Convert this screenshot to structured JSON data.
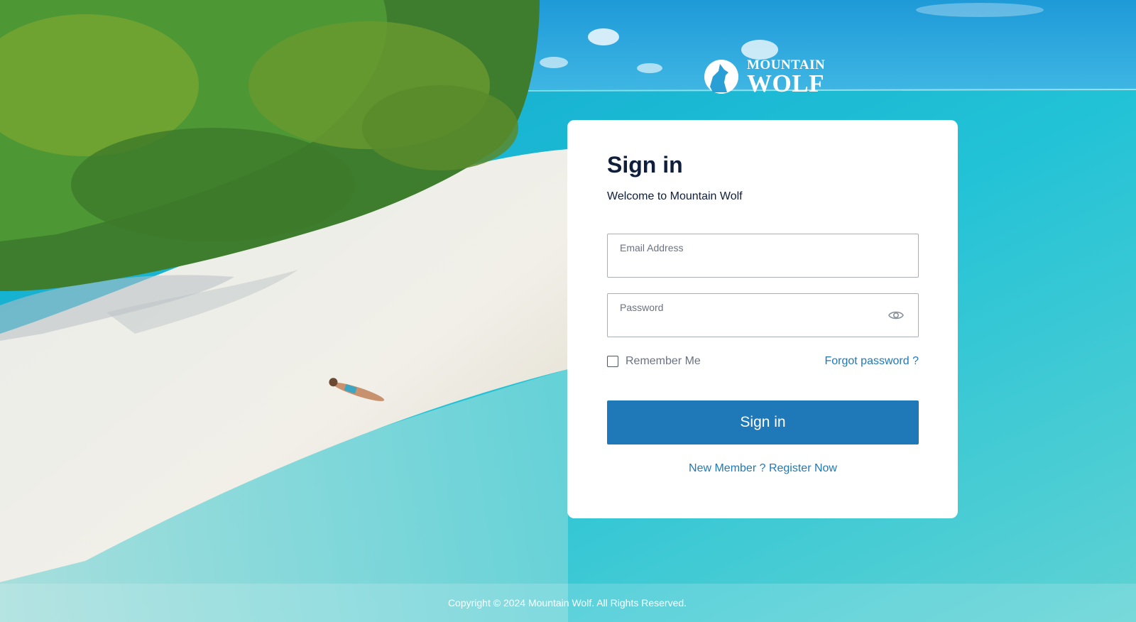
{
  "brand": {
    "logo_line1": "MOUNTAIN",
    "logo_line2": "WOLF",
    "logo_icon": "wolf-howling-icon"
  },
  "signin": {
    "title": "Sign in",
    "subtitle": "Welcome to Mountain Wolf",
    "email_label": "Email Address",
    "email_value": "",
    "password_label": "Password",
    "password_value": "",
    "password_toggle_icon": "eye-icon",
    "remember_label": "Remember Me",
    "remember_checked": false,
    "forgot_label": "Forgot password ?",
    "submit_label": "Sign in",
    "register_label": "New Member ? Register Now"
  },
  "footer": {
    "copyright": "Copyright © 2024 Mountain Wolf. All Rights Reserved."
  },
  "colors": {
    "accent": "#1f78b8",
    "heading": "#0f1e3a",
    "card_bg": "#ffffff"
  }
}
